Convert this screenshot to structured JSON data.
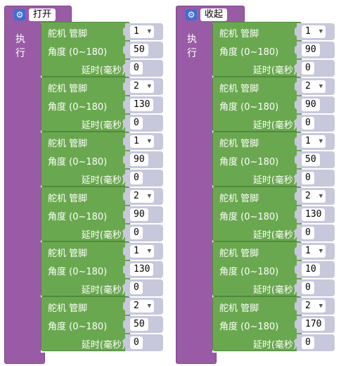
{
  "procedures": [
    {
      "name": "打开",
      "exec_label": "执行",
      "blocks": [
        {
          "servo_label": "舵机 管脚",
          "pin": "1",
          "angle_label": "角度 (0~180)",
          "angle": "50",
          "delay_label": "延时(毫秒)",
          "delay": "0"
        },
        {
          "servo_label": "舵机 管脚",
          "pin": "2",
          "angle_label": "角度 (0~180)",
          "angle": "130",
          "delay_label": "延时(毫秒)",
          "delay": "0"
        },
        {
          "servo_label": "舵机 管脚",
          "pin": "1",
          "angle_label": "角度 (0~180)",
          "angle": "90",
          "delay_label": "延时(毫秒)",
          "delay": "0"
        },
        {
          "servo_label": "舵机 管脚",
          "pin": "2",
          "angle_label": "角度 (0~180)",
          "angle": "90",
          "delay_label": "延时(毫秒)",
          "delay": "0"
        },
        {
          "servo_label": "舵机 管脚",
          "pin": "1",
          "angle_label": "角度 (0~180)",
          "angle": "130",
          "delay_label": "延时(毫秒)",
          "delay": "0"
        },
        {
          "servo_label": "舵机 管脚",
          "pin": "2",
          "angle_label": "角度 (0~180)",
          "angle": "50",
          "delay_label": "延时(毫秒)",
          "delay": "0"
        }
      ]
    },
    {
      "name": "收起",
      "exec_label": "执行",
      "blocks": [
        {
          "servo_label": "舵机 管脚",
          "pin": "1",
          "angle_label": "角度 (0~180)",
          "angle": "90",
          "delay_label": "延时(毫秒)",
          "delay": "0"
        },
        {
          "servo_label": "舵机 管脚",
          "pin": "2",
          "angle_label": "角度 (0~180)",
          "angle": "90",
          "delay_label": "延时(毫秒)",
          "delay": "0"
        },
        {
          "servo_label": "舵机 管脚",
          "pin": "1",
          "angle_label": "角度 (0~180)",
          "angle": "50",
          "delay_label": "延时(毫秒)",
          "delay": "0"
        },
        {
          "servo_label": "舵机 管脚",
          "pin": "2",
          "angle_label": "角度 (0~180)",
          "angle": "130",
          "delay_label": "延时(毫秒)",
          "delay": "0"
        },
        {
          "servo_label": "舵机 管脚",
          "pin": "1",
          "angle_label": "角度 (0~180)",
          "angle": "10",
          "delay_label": "延时(毫秒)",
          "delay": "0"
        },
        {
          "servo_label": "舵机 管脚",
          "pin": "2",
          "angle_label": "角度 (0~180)",
          "angle": "170",
          "delay_label": "延时(毫秒)",
          "delay": "0"
        }
      ]
    }
  ],
  "icons": {
    "procedure": "gear-icon",
    "dropdown": "triangle-down-icon"
  },
  "colors": {
    "procedure": "#995ba5",
    "servo_block": "#6aa84f",
    "input_socket": "#c7c8dc",
    "gear": "#3b6fd6"
  }
}
